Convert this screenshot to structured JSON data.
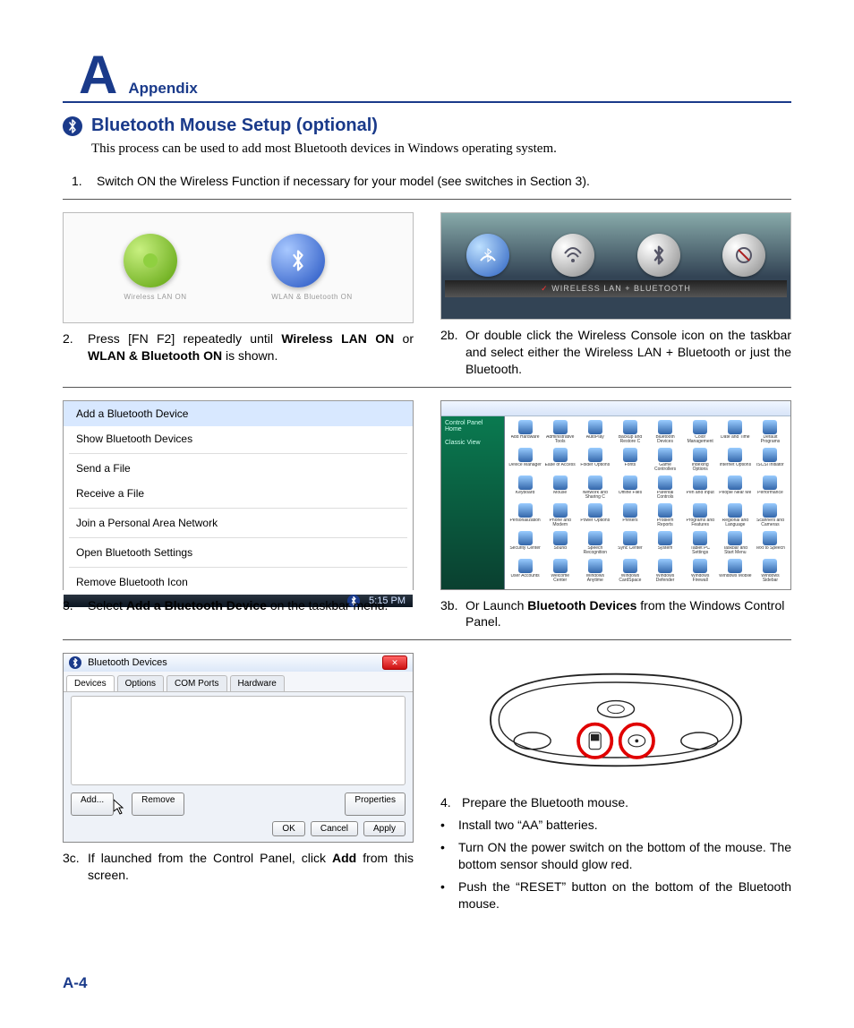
{
  "header": {
    "letter": "A",
    "label": "Appendix"
  },
  "section": {
    "title": "Bluetooth Mouse Setup (optional)",
    "intro": "This process can be used to add most Bluetooth devices in Windows operating system."
  },
  "steps": {
    "s1_num": "1.",
    "s1": "Switch ON the Wireless Function if necessary for your model (see switches in Section 3).",
    "s2_num": "2.",
    "s2_pre": "Press [FN F2] repeatedly until ",
    "s2_b1": "Wireless LAN ON",
    "s2_mid": " or ",
    "s2_b2": "WLAN & Bluetooth ON",
    "s2_post": " is shown.",
    "s2b_num": "2b.",
    "s2b": "Or double click the Wireless Console icon on the taskbar and select either the Wireless LAN + Bluetooth or just the Bluetooth.",
    "s3_num": "3.",
    "s3_pre": "Select ",
    "s3_b": "Add a Bluetooth Device",
    "s3_post": " on the taskbar menu.",
    "s3b_num": "3b.",
    "s3b_pre": "Or Launch ",
    "s3b_b": "Bluetooth Devices",
    "s3b_post": " from the Windows Control Panel.",
    "s3c_num": "3c.",
    "s3c_pre": "If launched from the Control Panel, click ",
    "s3c_b": "Add",
    "s3c_post": " from this screen.",
    "s4_num": "4.",
    "s4": "Prepare the Bluetooth mouse.",
    "s4_b1": "Install two “AA” batteries.",
    "s4_b2": "Turn ON the power switch on the bottom of the mouse. The bottom sensor should glow red.",
    "s4_b3": "Push the “RESET” button on the bottom of the Bluetooth mouse."
  },
  "fig2l": {
    "cap1": "Wireless LAN ON",
    "cap2": "WLAN & Bluetooth ON"
  },
  "fig2r": {
    "bar": "WIRELESS LAN + BLUETOOTH",
    "check": "✓"
  },
  "menu": {
    "items": [
      "Add a Bluetooth Device",
      "Show Bluetooth Devices",
      "Send a File",
      "Receive a File",
      "Join a Personal Area Network",
      "Open Bluetooth Settings",
      "Remove Bluetooth Icon"
    ],
    "time": "5:15 PM"
  },
  "control_panel": {
    "side1": "Control Panel Home",
    "side2": "Classic View",
    "icons": [
      "Add Hardware",
      "Administrative Tools",
      "AutoPlay",
      "Backup and Restore C",
      "Bluetooth Devices",
      "Color Management",
      "Date and Time",
      "Default Programs",
      "Device Manager",
      "Ease of Access",
      "Folder Options",
      "Fonts",
      "Game Controllers",
      "Indexing Options",
      "Internet Options",
      "iSCSI Initiator",
      "Keyboard",
      "Mouse",
      "Network and Sharing C",
      "Offline Files",
      "Parental Controls",
      "Pen and Input",
      "People Near Me",
      "Performance",
      "Personalization",
      "Phone and Modem",
      "Power Options",
      "Printers",
      "Problem Reports",
      "Programs and Features",
      "Regional and Language",
      "Scanners and Cameras",
      "Security Center",
      "Sound",
      "Speech Recognition",
      "Sync Center",
      "System",
      "Tablet PC Settings",
      "Taskbar and Start Menu",
      "Text to Speech",
      "User Accounts",
      "Welcome Center",
      "Windows Anytime",
      "Windows CardSpace",
      "Windows Defender",
      "Windows Firewall",
      "Windows Mobile",
      "Windows Sidebar"
    ]
  },
  "dialog": {
    "title": "Bluetooth Devices",
    "tabs": [
      "Devices",
      "Options",
      "COM Ports",
      "Hardware"
    ],
    "buttons": {
      "add": "Add...",
      "remove": "Remove",
      "properties": "Properties",
      "ok": "OK",
      "cancel": "Cancel",
      "apply": "Apply"
    }
  },
  "page_number": "A-4",
  "glyphs": {
    "bt": "฿",
    "bullet": "•"
  }
}
